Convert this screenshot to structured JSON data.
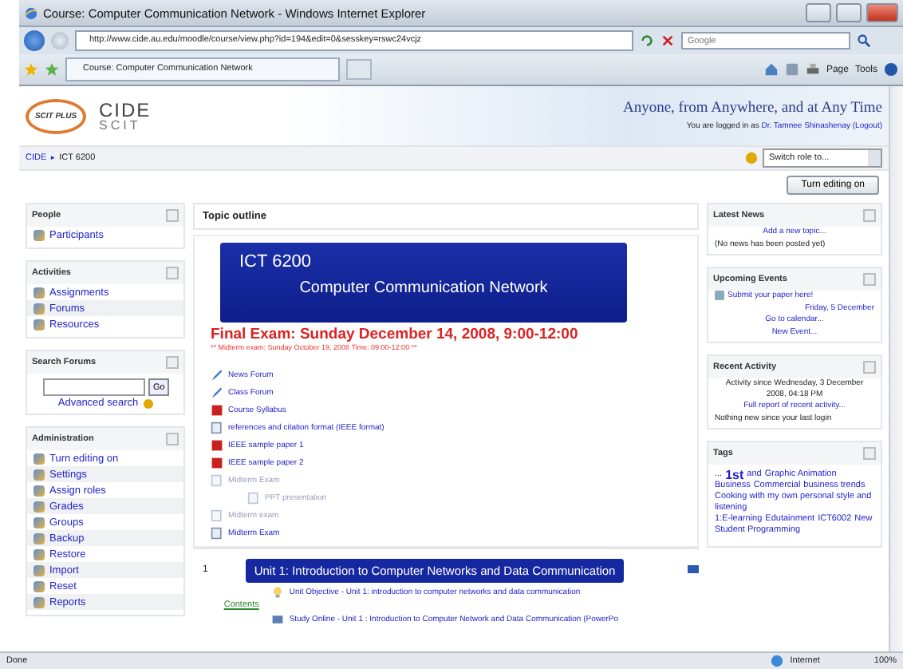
{
  "window": {
    "title": "Course: Computer Communication Network - Windows Internet Explorer"
  },
  "address_bar": {
    "url": "http://www.cide.au.edu/moodle/course/view.php?id=194&edit=0&sesskey=rswc24vcjz",
    "search_placeholder": "Google"
  },
  "tab": {
    "label": "Course: Computer Communication Network"
  },
  "command_bar": {
    "items": [
      "Page",
      "Tools"
    ]
  },
  "header": {
    "logo_left": "SCIT PLUS",
    "logo_top": "CIDE",
    "logo_bottom": "SCIT",
    "tagline": "Anyone, from Anywhere, and at Any Time",
    "login_text": "You are logged in as",
    "login_user": "Dr. Tamnee Shinashenay",
    "logout": "(Logout)",
    "switch_role": "Switch role to..."
  },
  "breadcrumb": {
    "home": "CIDE",
    "separator": "►",
    "current": "ICT 6200"
  },
  "edit_button": "Turn editing on",
  "left_blocks": [
    {
      "title": "People",
      "kind": "list",
      "items": [
        "Participants"
      ]
    },
    {
      "title": "Activities",
      "kind": "list",
      "items": [
        "Assignments",
        "Forums",
        "Resources"
      ]
    },
    {
      "title": "Search Forums",
      "kind": "search",
      "button": "Go",
      "link": "Advanced search"
    },
    {
      "title": "Administration",
      "kind": "list",
      "items": [
        "Turn editing on",
        "Settings",
        "Assign roles",
        "Grades",
        "Groups",
        "Backup",
        "Restore",
        "Import",
        "Reset",
        "Reports"
      ]
    }
  ],
  "center": {
    "title": "Topic outline",
    "banner_code": "ICT 6200",
    "banner_name": "Computer Communication Network",
    "final_exam": "Final Exam: Sunday December 14, 2008, 9:00-12:00",
    "midterm_note": "** Midterm exam: Sunday October 19, 2008 Time: 09:00-12:00 **",
    "resources": [
      {
        "label": "News Forum",
        "kind": "forum",
        "hidden": false
      },
      {
        "label": "Class Forum",
        "kind": "forum",
        "hidden": false
      },
      {
        "label": "Course Syllabus",
        "kind": "pdf",
        "hidden": false
      },
      {
        "label": "references and citation format (IEEE format)",
        "kind": "doc",
        "hidden": false
      },
      {
        "label": "IEEE sample paper 1",
        "kind": "pdf",
        "hidden": false
      },
      {
        "label": "IEEE sample paper 2",
        "kind": "pdf",
        "hidden": false
      },
      {
        "label": "Midterm Exam",
        "kind": "doc",
        "hidden": true,
        "children": [
          {
            "label": "PPT presentation",
            "kind": "doc",
            "hidden": true
          }
        ]
      },
      {
        "label": "Midterm exam",
        "kind": "doc",
        "hidden": true
      },
      {
        "label": "Midterm Exam",
        "kind": "doc",
        "hidden": false
      }
    ],
    "unit": {
      "number": "1",
      "title": "Unit 1: Introduction to Computer Networks and Data Communication",
      "objective": "Unit Objective - Unit 1: introduction to computer networks and data communication",
      "contents": "Contents",
      "study": "Study Online - Unit 1 : Introduction to Computer Network and Data Communication (PowerPo"
    }
  },
  "right_blocks": [
    {
      "title": "Latest News",
      "lines": [
        {
          "text": "Add a new topic...",
          "kind": "link"
        },
        {
          "text": "(No news has been posted yet)",
          "kind": "text"
        }
      ]
    },
    {
      "title": "Upcoming Events",
      "lines": [
        {
          "text": "Submit your paper here!",
          "kind": "event"
        },
        {
          "text": "Friday, 5 December",
          "kind": "date"
        },
        {
          "text": "Go to calendar...",
          "kind": "link"
        },
        {
          "text": "New Event...",
          "kind": "link"
        }
      ]
    },
    {
      "title": "Recent Activity",
      "lines": [
        {
          "text": "Activity since Wednesday, 3 December 2008, 04:18 PM",
          "kind": "note"
        },
        {
          "text": "Full report of recent activity...",
          "kind": "link"
        },
        {
          "text": "Nothing new since your last login",
          "kind": "text"
        }
      ]
    },
    {
      "title": "Tags",
      "tags": [
        {
          "text": "...",
          "kind": "normal"
        },
        {
          "text": "1st",
          "kind": "large"
        },
        {
          "text": "and",
          "kind": "normal"
        },
        {
          "text": "Graphic Animation",
          "kind": "normal"
        },
        {
          "text": "Business",
          "kind": "normal"
        },
        {
          "text": "Commercial",
          "kind": "normal"
        },
        {
          "text": "business trends",
          "kind": "normal"
        },
        {
          "text": "Cooking with my own personal style and listening",
          "kind": "normal"
        },
        {
          "text": "1:E-learning",
          "kind": "normal"
        },
        {
          "text": "Edutainment",
          "kind": "normal"
        },
        {
          "text": "ICT6002",
          "kind": "normal"
        },
        {
          "text": "New",
          "kind": "normal"
        },
        {
          "text": "Student Programming",
          "kind": "normal"
        }
      ]
    }
  ],
  "status_bar": {
    "text": "Done",
    "zone": "Internet",
    "zoom": "100%"
  }
}
